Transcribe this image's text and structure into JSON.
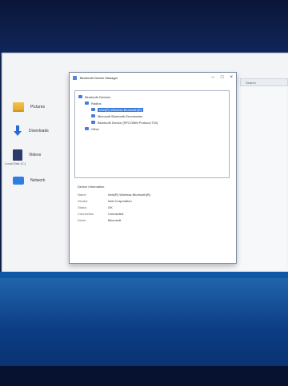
{
  "window": {
    "title": "Bluetooth Device Manager"
  },
  "sidebar": {
    "items": [
      {
        "label": "Pictures",
        "icon": "folder-icon"
      },
      {
        "label": "Downloads",
        "icon": "download-icon"
      },
      {
        "label": "Videos",
        "icon": "video-icon"
      },
      {
        "label": "Network",
        "icon": "network-icon"
      }
    ],
    "extra_label": "Local Disk (C:)"
  },
  "right_panel": {
    "search_hint": "Search"
  },
  "device_tree": {
    "root": "Bluetooth Devices",
    "group": "Radios",
    "items": [
      {
        "label": "Intel(R) Wireless Bluetooth(R)",
        "selected": true
      },
      {
        "label": "Microsoft Bluetooth Enumerator",
        "selected": false
      },
      {
        "label": "Bluetooth Device (RFCOMM Protocol TDI)",
        "selected": false
      }
    ],
    "other": "Other"
  },
  "properties": {
    "header": "Device Information",
    "rows": [
      {
        "key": "Name",
        "value": "Intel(R) Wireless Bluetooth(R)"
      },
      {
        "key": "Vendor",
        "value": "Intel Corporation"
      },
      {
        "key": "Status",
        "value": "OK"
      },
      {
        "key": "Connection",
        "value": "Connected"
      },
      {
        "key": "Driver",
        "value": "Microsoft"
      }
    ]
  },
  "colors": {
    "accent": "#3a7be0",
    "desktop_blue": "#0e5aa8"
  }
}
